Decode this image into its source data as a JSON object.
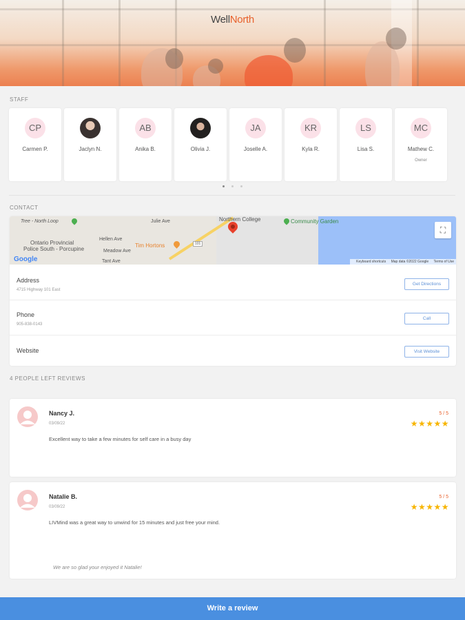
{
  "brand": {
    "part1": "Well",
    "part2": "North"
  },
  "staff": {
    "label": "STAFF",
    "members": [
      {
        "initials": "CP",
        "name": "Carmen P.",
        "role": ""
      },
      {
        "initials": "",
        "name": "Jaclyn N.",
        "role": ""
      },
      {
        "initials": "AB",
        "name": "Anika B.",
        "role": ""
      },
      {
        "initials": "",
        "name": "Olivia J.",
        "role": ""
      },
      {
        "initials": "JA",
        "name": "Joselle A.",
        "role": ""
      },
      {
        "initials": "KR",
        "name": "Kyla R.",
        "role": ""
      },
      {
        "initials": "LS",
        "name": "Lisa S.",
        "role": ""
      },
      {
        "initials": "MC",
        "name": "Mathew C.",
        "role": "Owner"
      }
    ]
  },
  "contact": {
    "label": "CONTACT",
    "map": {
      "labels": {
        "tree": "Tree - North Loop",
        "police1": "Ontario Provincial",
        "police2": "Police South - Porcupine",
        "tim": "Tim Hortons",
        "community": "Community Garden",
        "julie": "Julie Ave",
        "hellen": "Hellen Ave",
        "meadow": "Meadow Ave",
        "tant": "Tant Ave",
        "center": "Northern College",
        "route": "101"
      },
      "google": "Google",
      "footer": [
        "Keyboard shortcuts",
        "Map data ©2022 Google",
        "Terms of Use"
      ]
    },
    "address": {
      "title": "Address",
      "value": "4715 Highway 101 East",
      "button": "Get Directions"
    },
    "phone": {
      "title": "Phone",
      "value": "905-838-0143",
      "button": "Call"
    },
    "website": {
      "title": "Website",
      "button": "Visit Website"
    }
  },
  "reviews": {
    "label": "4 PEOPLE LEFT REVIEWS",
    "items": [
      {
        "name": "Nancy J.",
        "date": "03/09/22",
        "score": "5 / 5",
        "stars": "★★★★★",
        "text": "Excellent way to take a few minutes for self care in a busy day",
        "reply": ""
      },
      {
        "name": "Natalie B.",
        "date": "03/09/22",
        "score": "5 / 5",
        "stars": "★★★★★",
        "text": "LIVMind was a great way to unwind for 15 minutes and just free your mind.",
        "reply": "We are so glad your enjoyed it Natalie!"
      }
    ]
  },
  "write_review": "Write a review",
  "colors": {
    "accent": "#e8612c",
    "button": "#4a8fe0",
    "star": "#f7b500"
  }
}
